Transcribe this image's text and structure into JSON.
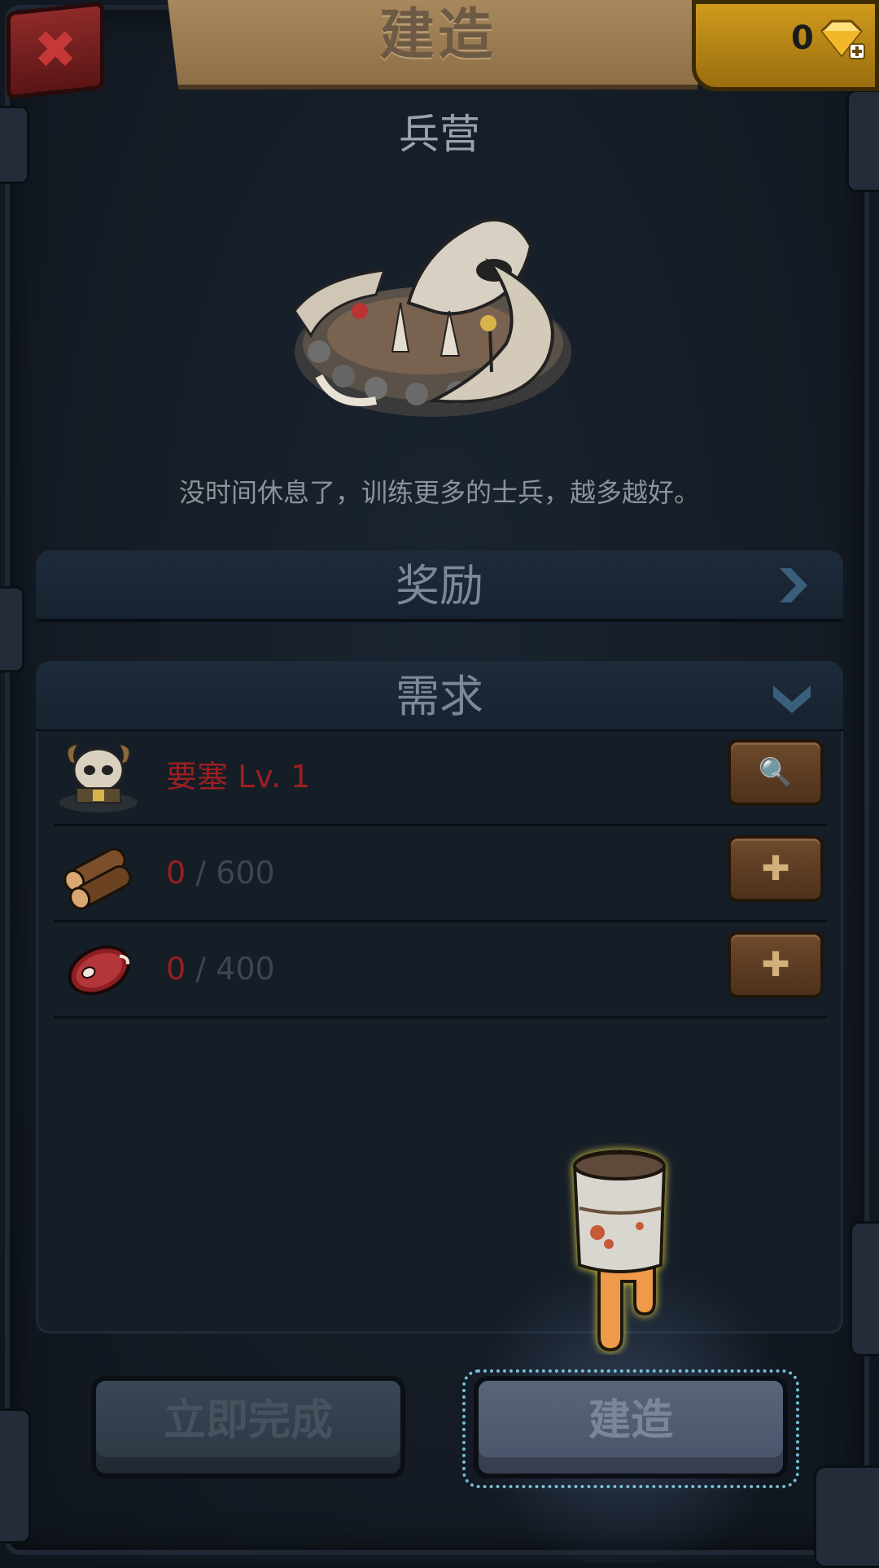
{
  "header": {
    "title": "建造",
    "close_glyph": "✖",
    "gems": "0"
  },
  "building": {
    "name": "兵营",
    "description": "没时间休息了，训练更多的士兵，越多越好。"
  },
  "panels": {
    "reward": {
      "label": "奖励"
    },
    "requirements": {
      "label": "需求"
    }
  },
  "requirements": [
    {
      "icon": "skull-fortress-icon",
      "name": "要塞",
      "level": "Lv. 1",
      "button_icon": "magnifier-icon",
      "button_glyph": "🔍"
    },
    {
      "icon": "wood-logs-icon",
      "have": "0",
      "need": "/ 600",
      "button_icon": "plus-icon",
      "button_glyph": "✚"
    },
    {
      "icon": "meat-icon",
      "have": "0",
      "need": "/ 400",
      "button_icon": "plus-icon",
      "button_glyph": "✚"
    }
  ],
  "buttons": {
    "instant_complete": "立即完成",
    "build": "建造"
  },
  "colors": {
    "background": "#141b24",
    "banner": "#a8895d",
    "close_button": "#8f2a2a",
    "gem_box": "#cf9a1b",
    "requirement_unmet": "#9b1f1f",
    "button_brown": "#6e4a2c",
    "accent_chevron": "#3a5f7a"
  }
}
